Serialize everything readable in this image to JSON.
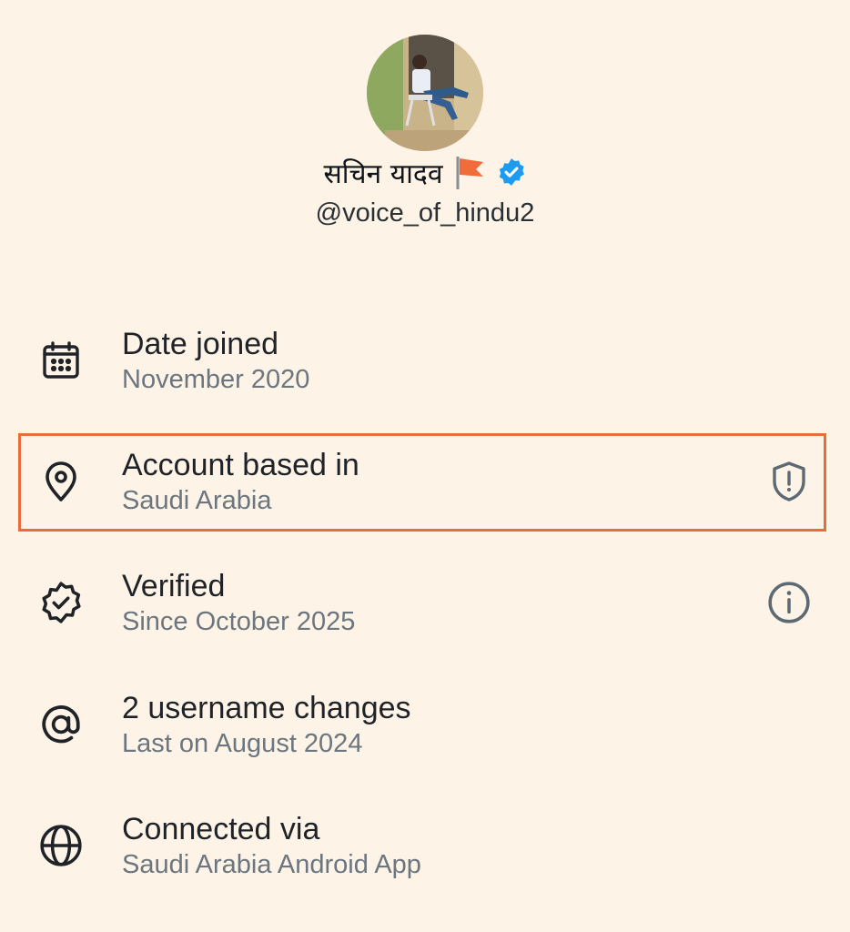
{
  "profile": {
    "display_name": "सचिन यादव",
    "handle": "@voice_of_hindu2",
    "flag_icon": "saffron-flag-icon",
    "verified_icon": "verified-badge-icon",
    "verified_color": "#1d9bf0"
  },
  "rows": [
    {
      "icon": "calendar-icon",
      "title": "Date joined",
      "subtitle": "November 2020"
    },
    {
      "icon": "location-pin-icon",
      "title": "Account based in",
      "subtitle": "Saudi Arabia",
      "action_icon": "shield-alert-icon",
      "highlighted": true
    },
    {
      "icon": "verified-outline-icon",
      "title": "Verified",
      "subtitle": "Since October 2025",
      "action_icon": "info-icon"
    },
    {
      "icon": "at-sign-icon",
      "title": "2 username changes",
      "subtitle": "Last on August 2024"
    },
    {
      "icon": "globe-icon",
      "title": "Connected via",
      "subtitle": "Saudi Arabia Android App"
    }
  ],
  "colors": {
    "background": "#fdf3e6",
    "highlight_border": "#ea6b3c",
    "subtitle": "#6b767f"
  }
}
